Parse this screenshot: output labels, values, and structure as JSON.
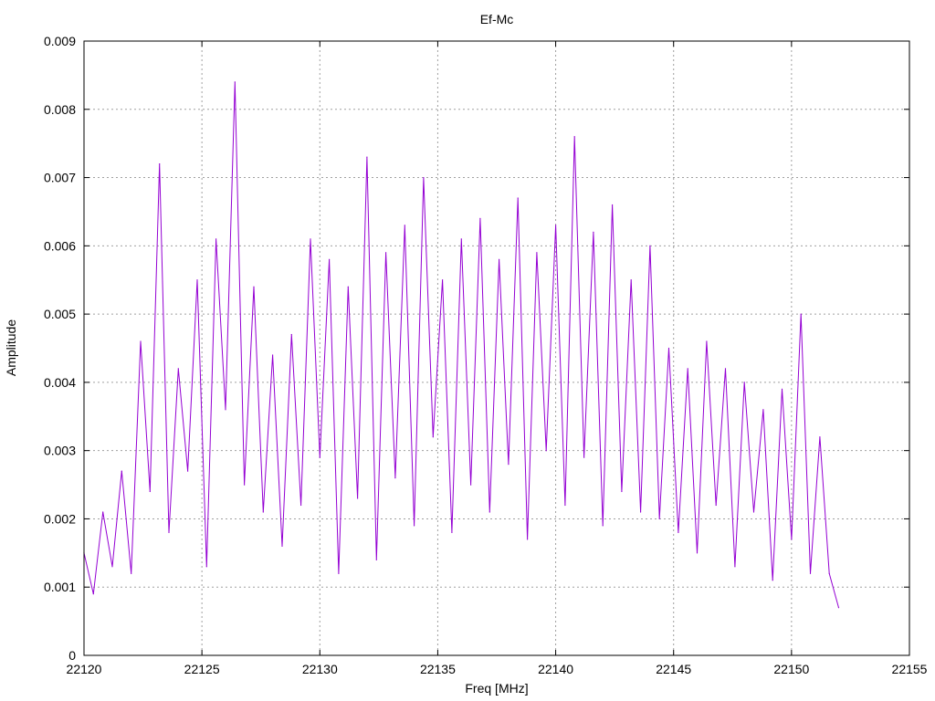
{
  "chart_data": {
    "type": "line",
    "title": "Ef-Mc",
    "xlabel": "Freq [MHz]",
    "ylabel": "Amplitude",
    "xlim": [
      22120,
      22155
    ],
    "ylim": [
      0,
      0.009
    ],
    "xticks": [
      "22120",
      "22125",
      "22130",
      "22135",
      "22140",
      "22145",
      "22150",
      "22155"
    ],
    "yticks": [
      "0",
      "0.001",
      "0.002",
      "0.003",
      "0.004",
      "0.005",
      "0.006",
      "0.007",
      "0.008",
      "0.009"
    ],
    "grid": true,
    "legend": "none",
    "series": [
      {
        "color": "#9400d3",
        "x": [
          22120.0,
          22120.4,
          22120.8,
          22121.2,
          22121.6,
          22122.0,
          22122.4,
          22122.8,
          22123.2,
          22123.6,
          22124.0,
          22124.4,
          22124.8,
          22125.2,
          22125.6,
          22126.0,
          22126.4,
          22126.8,
          22127.2,
          22127.6,
          22128.0,
          22128.4,
          22128.8,
          22129.2,
          22129.6,
          22130.0,
          22130.4,
          22130.8,
          22131.2,
          22131.6,
          22132.0,
          22132.4,
          22132.8,
          22133.2,
          22133.6,
          22134.0,
          22134.4,
          22134.8,
          22135.2,
          22135.6,
          22136.0,
          22136.4,
          22136.8,
          22137.2,
          22137.6,
          22138.0,
          22138.4,
          22138.8,
          22139.2,
          22139.6,
          22140.0,
          22140.4,
          22140.8,
          22141.2,
          22141.6,
          22142.0,
          22142.4,
          22142.8,
          22143.2,
          22143.6,
          22144.0,
          22144.4,
          22144.8,
          22145.2,
          22145.6,
          22146.0,
          22146.4,
          22146.8,
          22147.2,
          22147.6,
          22148.0,
          22148.4,
          22148.8,
          22149.2,
          22149.6,
          22150.0,
          22150.4,
          22150.8,
          22151.2,
          22151.6,
          22152.0
        ],
        "y": [
          0.0015,
          0.0009,
          0.0021,
          0.0013,
          0.0027,
          0.0012,
          0.0046,
          0.0024,
          0.0072,
          0.0018,
          0.0042,
          0.0027,
          0.0055,
          0.0013,
          0.0061,
          0.0036,
          0.0084,
          0.0025,
          0.0054,
          0.0021,
          0.0044,
          0.0016,
          0.0047,
          0.0022,
          0.0061,
          0.0029,
          0.0058,
          0.0012,
          0.0054,
          0.0023,
          0.0073,
          0.0014,
          0.0059,
          0.0026,
          0.0063,
          0.0019,
          0.007,
          0.0032,
          0.0055,
          0.0018,
          0.0061,
          0.0025,
          0.0064,
          0.0021,
          0.0058,
          0.0028,
          0.0067,
          0.0017,
          0.0059,
          0.003,
          0.0063,
          0.0022,
          0.0076,
          0.0029,
          0.0062,
          0.0019,
          0.0066,
          0.0024,
          0.0055,
          0.0021,
          0.006,
          0.002,
          0.0045,
          0.0018,
          0.0042,
          0.0015,
          0.0046,
          0.0022,
          0.0042,
          0.0013,
          0.004,
          0.0021,
          0.0036,
          0.0011,
          0.0039,
          0.0017,
          0.005,
          0.0012,
          0.0032,
          0.0012,
          0.0007
        ]
      }
    ]
  }
}
